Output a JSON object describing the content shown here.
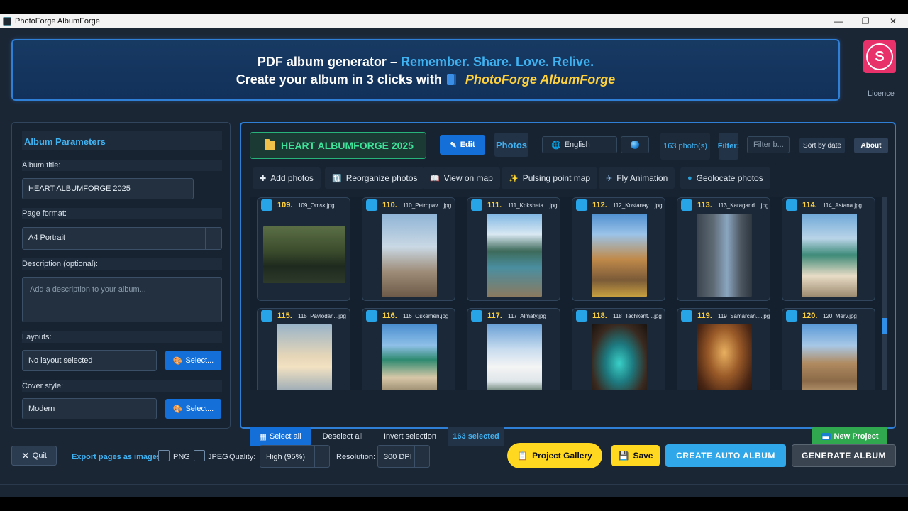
{
  "window": {
    "title": "PhotoForge AlbumForge"
  },
  "banner": {
    "line1_prefix": "PDF album generator – ",
    "line1_accent": "Remember. Share. Love. Relive.",
    "line2_prefix": "Create your album in 3 clicks with",
    "line2_brand": "PhotoForge AlbumForge"
  },
  "user": {
    "initial": "S",
    "licence_label": "Licence"
  },
  "params": {
    "header": "Album Parameters",
    "album_title_label": "Album title:",
    "album_title_value": "HEART ALBUMFORGE 2025",
    "page_format_label": "Page format:",
    "page_format_value": "A4 Portrait",
    "description_label": "Description (optional):",
    "description_placeholder": "Add a description to your album...",
    "layouts_label": "Layouts:",
    "layouts_value": "No layout selected",
    "layouts_button": "Select...",
    "cover_label": "Cover style:",
    "cover_value": "Modern",
    "cover_button": "Select..."
  },
  "toolbar": {
    "project_name": "HEART ALBUMFORGE 2025",
    "edit": "Edit",
    "photos": "Photos",
    "language": "English",
    "photo_count": "163 photo(s)",
    "filter_label": "Filter:",
    "filter_placeholder": "Filter b...",
    "sort": "Sort by date",
    "about": "About"
  },
  "actions": [
    {
      "label": "Add photos",
      "icon": "plus-icon",
      "glyph": "✚"
    },
    {
      "label": "Reorganize photos",
      "icon": "reorganize-icon",
      "glyph": "🔃"
    },
    {
      "label": "View on map",
      "icon": "map-icon",
      "glyph": "📖"
    },
    {
      "label": "Pulsing point map",
      "icon": "sparkle-icon",
      "glyph": "✨"
    },
    {
      "label": "Fly Animation",
      "icon": "plane-icon",
      "glyph": "✈"
    },
    {
      "label": "Geolocate photos",
      "icon": "globe-icon",
      "glyph": "●"
    }
  ],
  "photos": [
    {
      "num": "109.",
      "file": "109_Omsk.jpg"
    },
    {
      "num": "110.",
      "file": "110_Petropav....jpg"
    },
    {
      "num": "111.",
      "file": "111_Koksheta....jpg"
    },
    {
      "num": "112.",
      "file": "112_Kostanay....jpg"
    },
    {
      "num": "113.",
      "file": "113_Karagand....jpg"
    },
    {
      "num": "114.",
      "file": "114_Astana.jpg"
    },
    {
      "num": "115.",
      "file": "115_Pavlodar....jpg"
    },
    {
      "num": "116.",
      "file": "116_Oskemen.jpg"
    },
    {
      "num": "117.",
      "file": "117_Almaty.jpg"
    },
    {
      "num": "118.",
      "file": "118_Tachkent....jpg"
    },
    {
      "num": "119.",
      "file": "119_Samarcan....jpg"
    },
    {
      "num": "120.",
      "file": "120_Merv.jpg"
    }
  ],
  "selection": {
    "select_all": "Select all",
    "deselect_all": "Deselect all",
    "invert": "Invert selection",
    "count": "163 selected",
    "new_project": "New Project"
  },
  "bottom": {
    "quit": "Quit",
    "export_label": "Export pages as images:",
    "png": "PNG",
    "jpeg": "JPEG",
    "quality_label": "Quality:",
    "quality_value": "High (95%)",
    "resolution_label": "Resolution:",
    "resolution_value": "300 DPI",
    "gallery": "Project Gallery",
    "save": "Save",
    "auto": "CREATE AUTO ALBUM",
    "generate": "GENERATE ALBUM"
  },
  "colors": {
    "accent": "#3fb2f2",
    "brand": "#ffd23c",
    "primary": "#1470d8",
    "success": "#2fa84f"
  }
}
